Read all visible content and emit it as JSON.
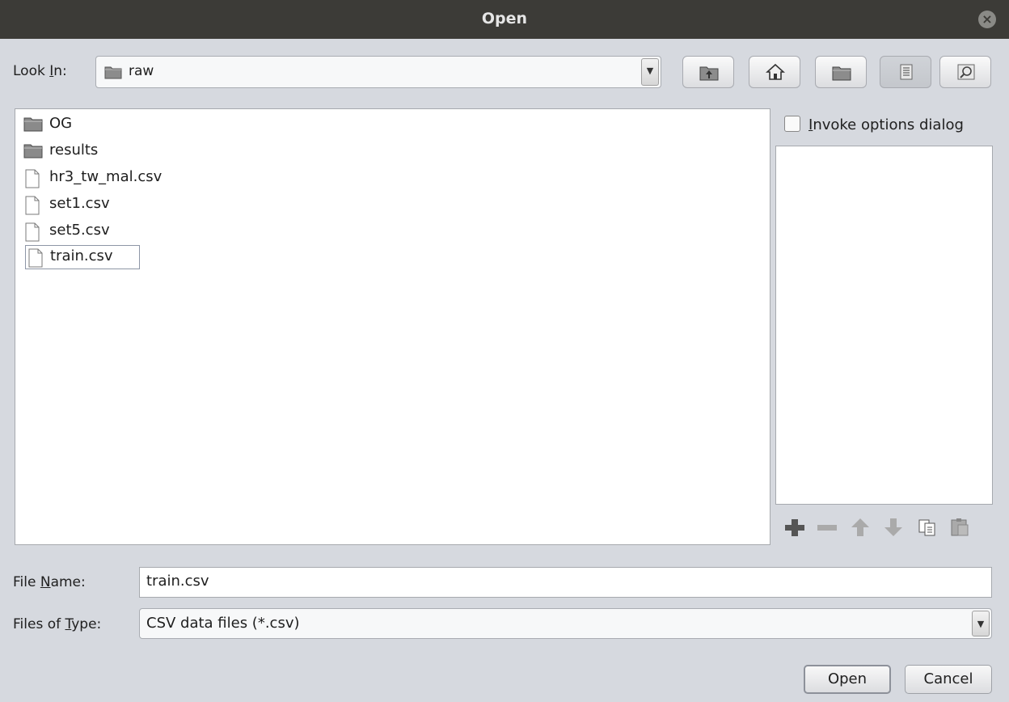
{
  "window": {
    "title": "Open"
  },
  "look_in": {
    "label_pre": "Look ",
    "label_mnemonic": "I",
    "label_post": "n:",
    "value": "raw"
  },
  "toolbar": {
    "buttons": [
      {
        "name": "up-one-level",
        "icon": "folder-up-icon"
      },
      {
        "name": "home",
        "icon": "home-icon"
      },
      {
        "name": "new-folder",
        "icon": "new-folder-icon"
      },
      {
        "name": "list-view",
        "icon": "list-view-icon",
        "pressed": true
      },
      {
        "name": "details-view",
        "icon": "details-view-icon"
      }
    ]
  },
  "files": [
    {
      "name": "OG",
      "type": "folder"
    },
    {
      "name": "results",
      "type": "folder"
    },
    {
      "name": "hr3_tw_mal.csv",
      "type": "file"
    },
    {
      "name": "set1.csv",
      "type": "file"
    },
    {
      "name": "set5.csv",
      "type": "file"
    },
    {
      "name": "train.csv",
      "type": "file",
      "selected": true
    }
  ],
  "options": {
    "checkbox_mnemonic": "I",
    "checkbox_rest": "nvoke options dialog",
    "checked": false
  },
  "file_name": {
    "label_pre": "File ",
    "label_mnemonic": "N",
    "label_post": "ame:",
    "value": "train.csv"
  },
  "file_type": {
    "label_pre": "Files of ",
    "label_mnemonic": "T",
    "label_post": "ype:",
    "value": "CSV data files (*.csv)"
  },
  "buttons": {
    "open": "Open",
    "cancel": "Cancel"
  },
  "colors": {
    "titlebar": "#3c3b37",
    "dialog_bg": "#d6d9df",
    "panel_bg": "#ffffff"
  }
}
